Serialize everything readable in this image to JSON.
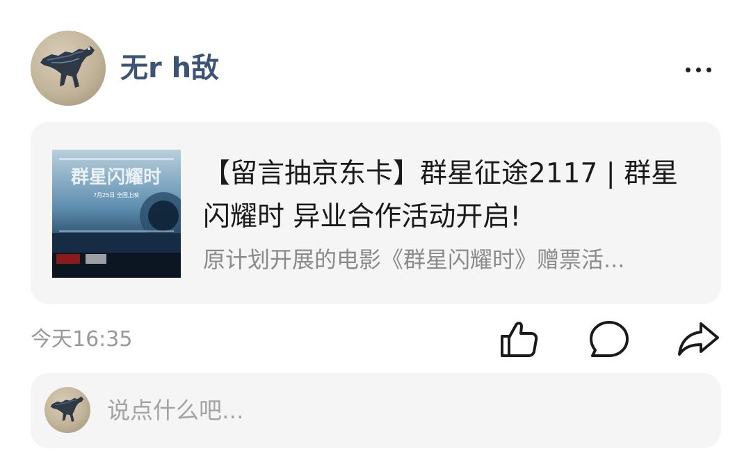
{
  "post": {
    "username": "无r h敌",
    "avatar_icon": "dinosaur-avatar",
    "more_icon": "more-dots-icon",
    "time": "今天16:35"
  },
  "card": {
    "title": "【留言抽京东卡】群星征途2117 | 群星闪耀时 异业合作活动开启!",
    "description": "原计划开展的电影《群星闪耀时》赠票活...",
    "thumbnail": {
      "poster_title": "群星闪耀时",
      "poster_date": "7月25日 全国上映"
    }
  },
  "actions": {
    "like_icon": "thumbs-up-icon",
    "comment_icon": "comment-bubble-icon",
    "share_icon": "share-arrow-icon"
  },
  "comment_bar": {
    "placeholder": "说点什么吧..."
  },
  "colors": {
    "username": "#3d5479",
    "card_bg": "#f5f5f5",
    "secondary_text": "#8a8a8a",
    "time_text": "#999999"
  }
}
